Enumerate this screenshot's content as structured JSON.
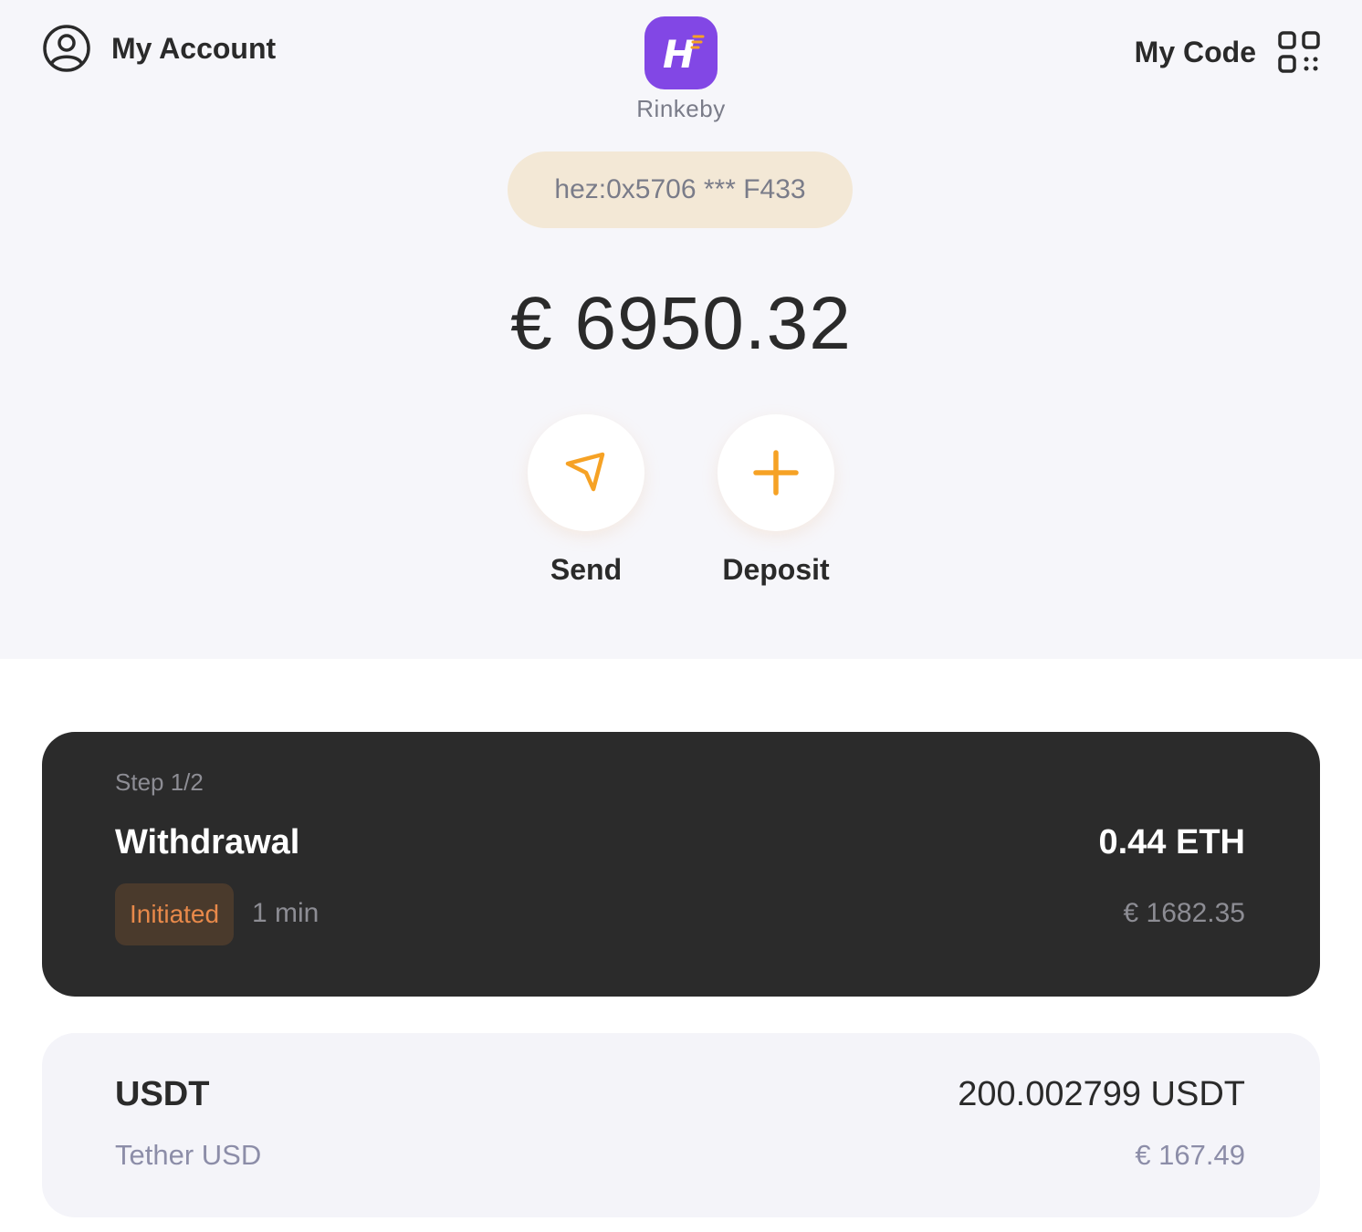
{
  "header": {
    "account_label": "My Account",
    "code_label": "My Code",
    "network": "Rinkeby",
    "logo_letter": "H"
  },
  "wallet": {
    "address": "hez:0x5706 *** F433",
    "balance": "€ 6950.32"
  },
  "actions": {
    "send_label": "Send",
    "deposit_label": "Deposit"
  },
  "pending_withdrawal": {
    "step": "Step 1/2",
    "title": "Withdrawal",
    "amount": "0.44 ETH",
    "status": "Initiated",
    "time": "1 min",
    "fiat": "€ 1682.35"
  },
  "tokens": [
    {
      "symbol": "USDT",
      "name": "Tether USD",
      "balance": "200.002799 USDT",
      "fiat": "€ 167.49"
    }
  ],
  "colors": {
    "accent": "#f6a225",
    "brand": "#8247e5",
    "background_top": "#f6f6fa",
    "pill": "#f3e8d6",
    "card_dark": "#2b2b2b",
    "card_light": "#f4f4f9"
  },
  "icons": {
    "account": "account-icon",
    "qr": "qr-code-icon",
    "send": "send-icon",
    "deposit": "plus-icon"
  }
}
